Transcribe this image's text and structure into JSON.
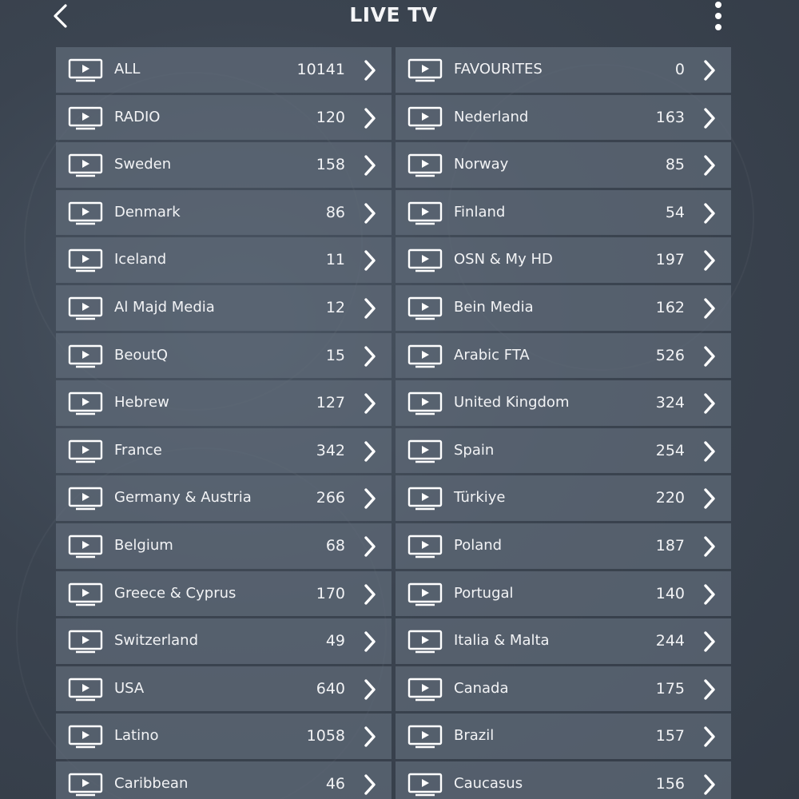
{
  "header": {
    "title": "LIVE TV",
    "back_icon": "chevron-left-icon",
    "menu_icon": "more-vertical-icon"
  },
  "colors": {
    "background": "#3b4450",
    "row_background": "#5a6573",
    "text": "#ffffff"
  },
  "categories": [
    {
      "label": "ALL",
      "count": "10141"
    },
    {
      "label": "FAVOURITES",
      "count": "0"
    },
    {
      "label": "RADIO",
      "count": "120"
    },
    {
      "label": "Nederland",
      "count": "163"
    },
    {
      "label": "Sweden",
      "count": "158"
    },
    {
      "label": "Norway",
      "count": "85"
    },
    {
      "label": "Denmark",
      "count": "86"
    },
    {
      "label": "Finland",
      "count": "54"
    },
    {
      "label": "Iceland",
      "count": "11"
    },
    {
      "label": "OSN & My HD",
      "count": "197"
    },
    {
      "label": "Al Majd Media",
      "count": "12"
    },
    {
      "label": "Bein Media",
      "count": "162"
    },
    {
      "label": "BeoutQ",
      "count": "15"
    },
    {
      "label": "Arabic FTA",
      "count": "526"
    },
    {
      "label": "Hebrew",
      "count": "127"
    },
    {
      "label": "United Kingdom",
      "count": "324"
    },
    {
      "label": "France",
      "count": "342"
    },
    {
      "label": "Spain",
      "count": "254"
    },
    {
      "label": "Germany & Austria",
      "count": "266"
    },
    {
      "label": "Türkiye",
      "count": "220"
    },
    {
      "label": "Belgium",
      "count": "68"
    },
    {
      "label": "Poland",
      "count": "187"
    },
    {
      "label": "Greece & Cyprus",
      "count": "170"
    },
    {
      "label": "Portugal",
      "count": "140"
    },
    {
      "label": "Switzerland",
      "count": "49"
    },
    {
      "label": "Italia & Malta",
      "count": "244"
    },
    {
      "label": "USA",
      "count": "640"
    },
    {
      "label": "Canada",
      "count": "175"
    },
    {
      "label": "Latino",
      "count": "1058"
    },
    {
      "label": "Brazil",
      "count": "157"
    },
    {
      "label": "Caribbean",
      "count": "46"
    },
    {
      "label": "Caucasus",
      "count": "156"
    }
  ]
}
